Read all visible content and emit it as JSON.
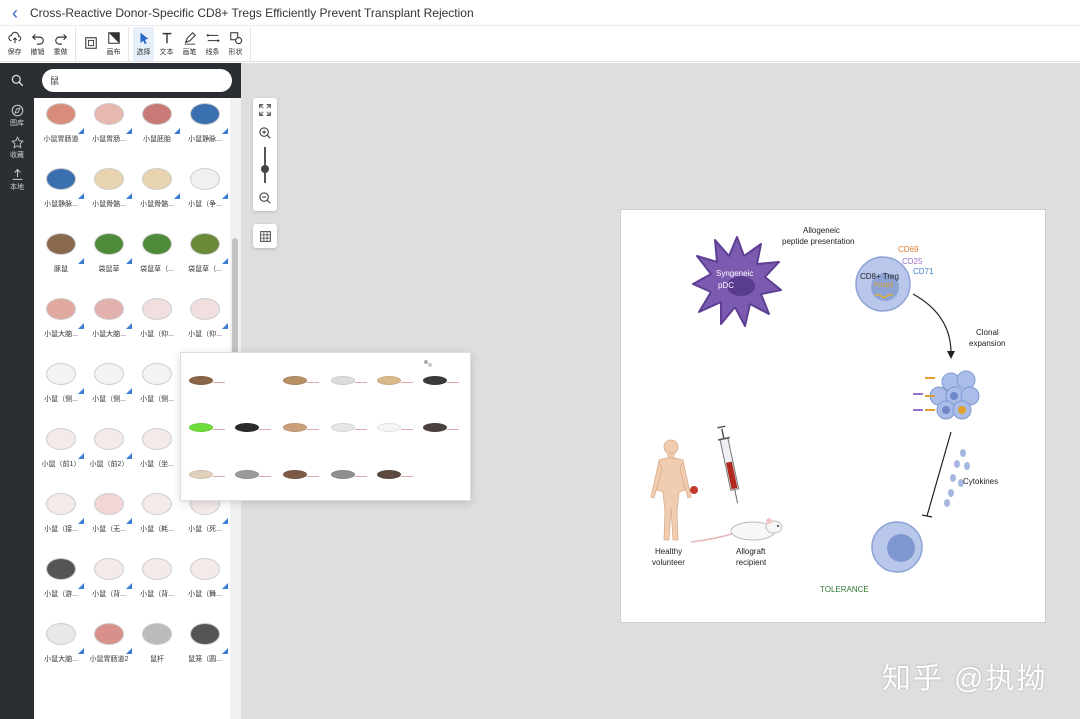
{
  "window": {
    "title": "Cross-Reactive Donor-Specific CD8+ Tregs Efficiently Prevent Transplant Rejection"
  },
  "toolbar": {
    "save": "保存",
    "undo": "撤销",
    "redo": "重做",
    "canvas": "画布",
    "select": "选择",
    "text": "文本",
    "pen": "画笔",
    "line": "线条",
    "shape": "形状"
  },
  "sidebar": {
    "gallery": "图库",
    "favorites": "收藏",
    "local": "本地"
  },
  "search": {
    "value": "鼠"
  },
  "library": {
    "items": [
      "小鼠胃肠道",
      "小鼠胃肠...",
      "小鼠胚胎",
      "小鼠静脉...",
      "小鼠静脉...",
      "小鼠骨骼...",
      "小鼠骨骼...",
      "小鼠（争...",
      "豚鼠",
      "袋鼠草",
      "袋鼠草（...",
      "袋鼠草（...",
      "小鼠大脑...",
      "小鼠大脑...",
      "小鼠（仰...",
      "小鼠（仰...",
      "小鼠（侧...",
      "小鼠（侧...",
      "小鼠（侧...",
      "",
      "小鼠（前1）",
      "小鼠（前2）",
      "小鼠（坐...",
      "",
      "小鼠（接...",
      "小鼠（无...",
      "小鼠（耗...",
      "小鼠（死...",
      "小鼠（游...",
      "小鼠（背...",
      "小鼠（背...",
      "小鼠（舞...",
      "小鼠大脑...",
      "小鼠胃肠道2",
      "鼠杆",
      "鼠笼（圆..."
    ]
  },
  "figure": {
    "allogeneic": "Allogeneic",
    "peptide": "peptide presentation",
    "syngeneic": "Syngeneic",
    "pdc": "pDC",
    "cd69": "CD69",
    "cd25": "CD25",
    "cd71": "CD71",
    "cd8treg": "CD8+  Treg",
    "foxp3": "Foxp3",
    "clonal": "Clonal",
    "expansion": "expansion",
    "cytokines": "Cytokines",
    "healthy": "Healthy",
    "volunteer": "volunteer",
    "allograft": "Allograft",
    "recipient": "recipient",
    "tolerance": "TOLERANCE"
  },
  "colors": {
    "accent": "#3b7fd6",
    "dc": "#7b5bb0",
    "cd69": "#e07b2e",
    "cd25": "#9a6fc9",
    "cd71": "#3d7fd0",
    "tolerance": "#2e7d32",
    "sidebar": "#2b2e33",
    "canvas": "#dedede"
  },
  "watermark": "知乎 @执拗"
}
